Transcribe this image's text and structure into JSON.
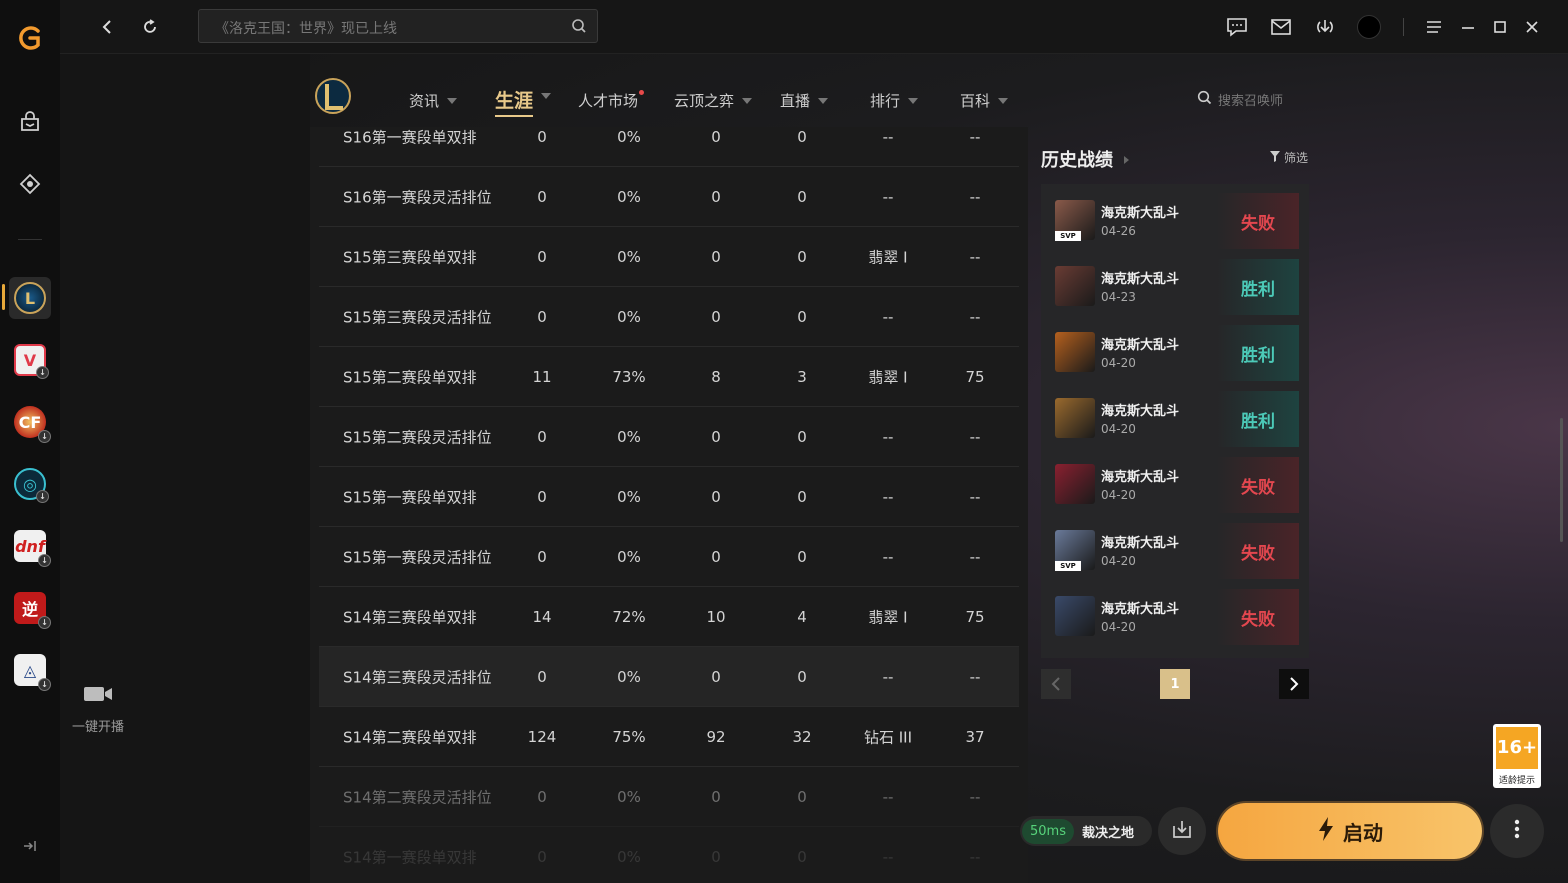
{
  "topbar": {
    "search_placeholder": "《洛克王国：世界》现已上线"
  },
  "sidebar": {
    "stream_label": "一键开播"
  },
  "nav": {
    "items": [
      "资讯",
      "生涯",
      "人才市场",
      "云顶之弈",
      "直播",
      "排行",
      "百科"
    ],
    "search_placeholder": "搜索召唤师"
  },
  "table": {
    "rows": [
      [
        "S16第一赛段单双排",
        "0",
        "0%",
        "0",
        "0",
        "--",
        "--"
      ],
      [
        "S16第一赛段灵活排位",
        "0",
        "0%",
        "0",
        "0",
        "--",
        "--"
      ],
      [
        "S15第三赛段单双排",
        "0",
        "0%",
        "0",
        "0",
        "翡翠 I",
        "--"
      ],
      [
        "S15第三赛段灵活排位",
        "0",
        "0%",
        "0",
        "0",
        "--",
        "--"
      ],
      [
        "S15第二赛段单双排",
        "11",
        "73%",
        "8",
        "3",
        "翡翠 I",
        "75"
      ],
      [
        "S15第二赛段灵活排位",
        "0",
        "0%",
        "0",
        "0",
        "--",
        "--"
      ],
      [
        "S15第一赛段单双排",
        "0",
        "0%",
        "0",
        "0",
        "--",
        "--"
      ],
      [
        "S15第一赛段灵活排位",
        "0",
        "0%",
        "0",
        "0",
        "--",
        "--"
      ],
      [
        "S14第三赛段单双排",
        "14",
        "72%",
        "10",
        "4",
        "翡翠 I",
        "75"
      ],
      [
        "S14第三赛段灵活排位",
        "0",
        "0%",
        "0",
        "0",
        "--",
        "--"
      ],
      [
        "S14第二赛段单双排",
        "124",
        "75%",
        "92",
        "32",
        "钻石 III",
        "37"
      ],
      [
        "S14第二赛段灵活排位",
        "0",
        "0%",
        "0",
        "0",
        "--",
        "--"
      ],
      [
        "S14第一赛段单双排",
        "0",
        "0%",
        "0",
        "0",
        "--",
        "--"
      ]
    ]
  },
  "history": {
    "title": "历史战绩",
    "filter_label": "筛选",
    "svp_label": "SVP",
    "matches": [
      {
        "mode": "海克斯大乱斗",
        "date": "04-26",
        "result": "失败",
        "svp": true,
        "color": "#8a5a4a"
      },
      {
        "mode": "海克斯大乱斗",
        "date": "04-23",
        "result": "胜利",
        "svp": false,
        "color": "#6a3c34"
      },
      {
        "mode": "海克斯大乱斗",
        "date": "04-20",
        "result": "胜利",
        "svp": false,
        "color": "#b5601e"
      },
      {
        "mode": "海克斯大乱斗",
        "date": "04-20",
        "result": "胜利",
        "svp": false,
        "color": "#9a6a2e"
      },
      {
        "mode": "海克斯大乱斗",
        "date": "04-20",
        "result": "失败",
        "svp": false,
        "color": "#8a2030"
      },
      {
        "mode": "海克斯大乱斗",
        "date": "04-20",
        "result": "失败",
        "svp": true,
        "color": "#6a7a9a"
      },
      {
        "mode": "海克斯大乱斗",
        "date": "04-20",
        "result": "失败",
        "svp": false,
        "color": "#3a4a6a"
      }
    ],
    "page": "1"
  },
  "bottom": {
    "ping": "50ms",
    "server": "裁决之地",
    "launch_label": "启动",
    "age_rating": "16+",
    "age_hint": "适龄提示"
  },
  "colors": {
    "accent": "#e8c98a",
    "win": "#4ccab8",
    "lose": "#e3474f",
    "launch": "#f5a640"
  }
}
